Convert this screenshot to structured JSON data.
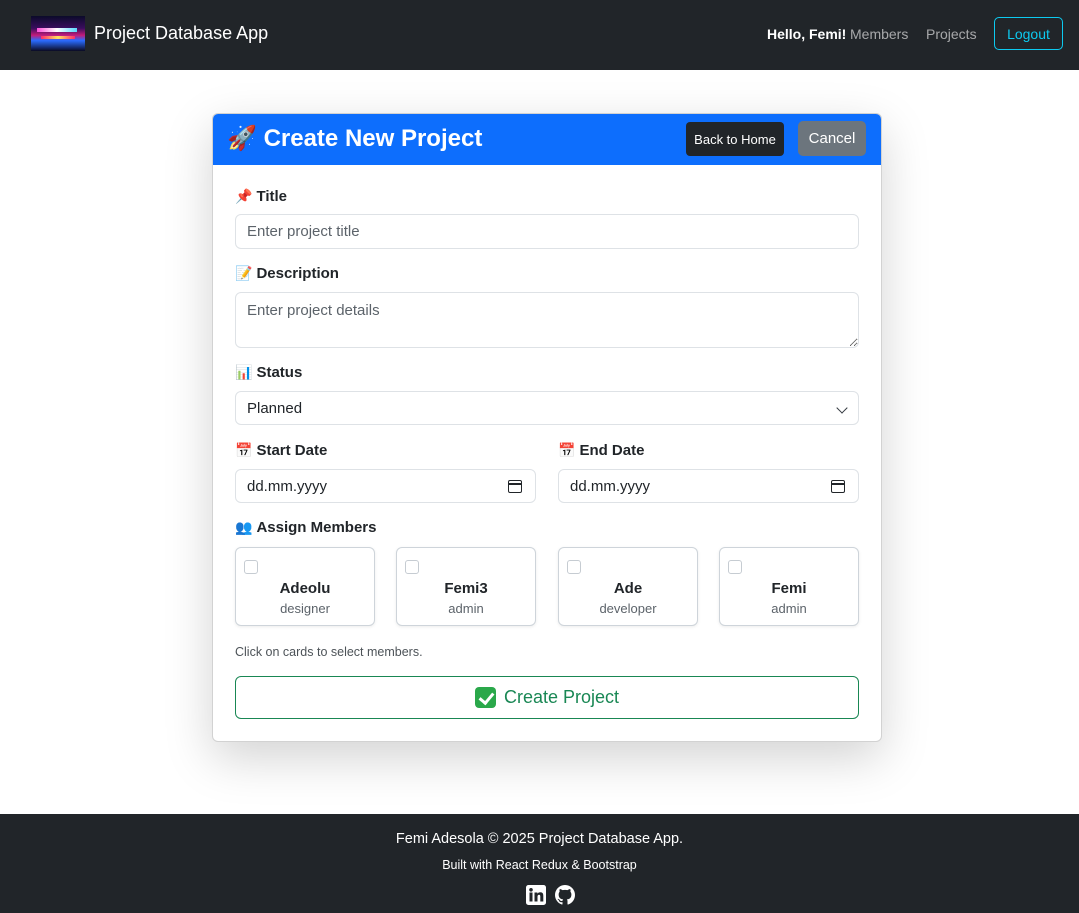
{
  "navbar": {
    "brand": "Project Database App",
    "greeting": "Hello, Femi!",
    "links": [
      "Members",
      "Projects"
    ],
    "logout": "Logout"
  },
  "form": {
    "header_emoji": "🚀",
    "title": "Create New Project",
    "back_button": "Back to Home",
    "cancel_button": "Cancel",
    "title_field": {
      "icon": "📌",
      "label": "Title",
      "placeholder": "Enter project title",
      "value": ""
    },
    "description_field": {
      "icon": "📝",
      "label": "Description",
      "placeholder": "Enter project details",
      "value": ""
    },
    "status_field": {
      "icon": "📊",
      "label": "Status",
      "selected": "Planned"
    },
    "start_date": {
      "icon": "📅",
      "label": "Start Date",
      "value": "dd.mm.yyyy"
    },
    "end_date": {
      "icon": "📅",
      "label": "End Date",
      "value": "dd.mm.yyyy"
    },
    "members_label": {
      "icon": "👥",
      "label": "Assign Members"
    },
    "members": [
      {
        "name": "Adeolu",
        "role": "designer",
        "checked": false
      },
      {
        "name": "Femi3",
        "role": "admin",
        "checked": false
      },
      {
        "name": "Ade",
        "role": "developer",
        "checked": false
      },
      {
        "name": "Femi",
        "role": "admin",
        "checked": false
      }
    ],
    "hint": "Click on cards to select members.",
    "submit": "Create Project"
  },
  "footer": {
    "line1": "Femi Adesola © 2025 Project Database App.",
    "line2": "Built with React Redux & Bootstrap",
    "icons": [
      "linkedin-icon",
      "github-icon"
    ]
  },
  "colors": {
    "navbar_bg": "#212529",
    "header_bg": "#0d6efd",
    "logout": "#0dcaf0",
    "success": "#198754",
    "secondary": "#6c757d"
  }
}
